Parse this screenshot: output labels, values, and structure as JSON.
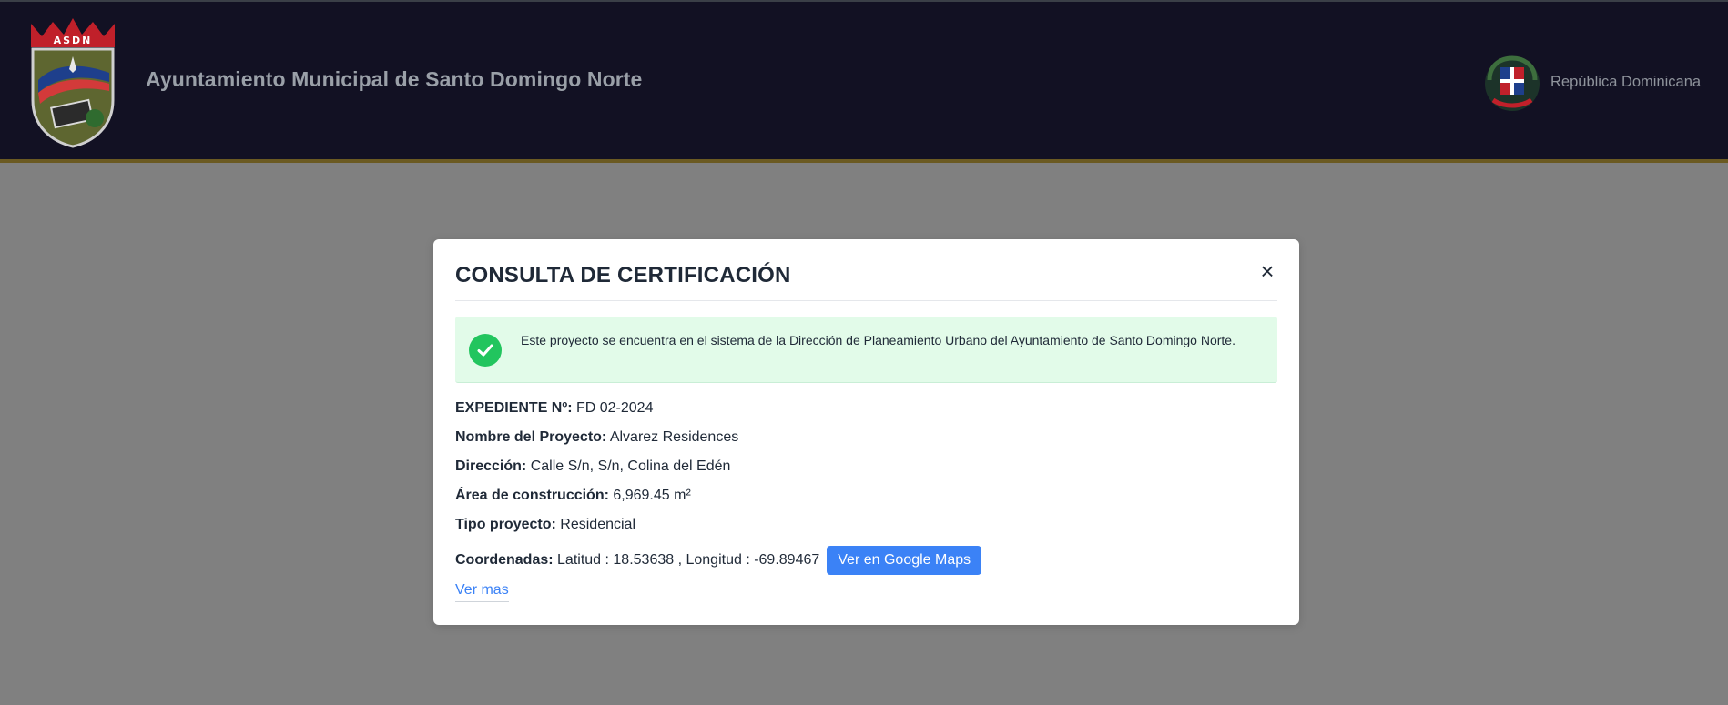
{
  "header": {
    "crest_text": "ASDN",
    "title": "Ayuntamiento Municipal de Santo Domingo Norte",
    "country": "República Dominicana"
  },
  "modal": {
    "title": "CONSULTA DE CERTIFICACIÓN",
    "close_label": "×",
    "alert": "Este proyecto se encuentra en el sistema de la Dirección de Planeamiento Urbano del Ayuntamiento de Santo Domingo Norte.",
    "fields": {
      "expediente_label": "EXPEDIENTE Nº:",
      "expediente_value": "FD 02-2024",
      "nombre_label": "Nombre del Proyecto:",
      "nombre_value": "Alvarez Residences",
      "direccion_label": "Dirección:",
      "direccion_value": "Calle S/n, S/n, Colina del Edén",
      "area_label": "Área de construcción:",
      "area_value": "6,969.45 m²",
      "tipo_label": "Tipo proyecto:",
      "tipo_value": "Residencial",
      "coords_label": "Coordenadas:",
      "coords_value": "Latitud : 18.53638 , Longitud : -69.89467"
    },
    "maps_button": "Ver en Google Maps",
    "ver_mas": "Ver mas"
  },
  "colors": {
    "header_bg": "#121123",
    "accent_gold": "#6b5a22",
    "success_bg": "#e2fbe9",
    "success_icon": "#22c55e",
    "primary": "#3b82f6"
  },
  "icons": [
    "municipal-crest-logo",
    "dominican-coat-of-arms-icon",
    "close-icon",
    "check-circle-icon"
  ]
}
